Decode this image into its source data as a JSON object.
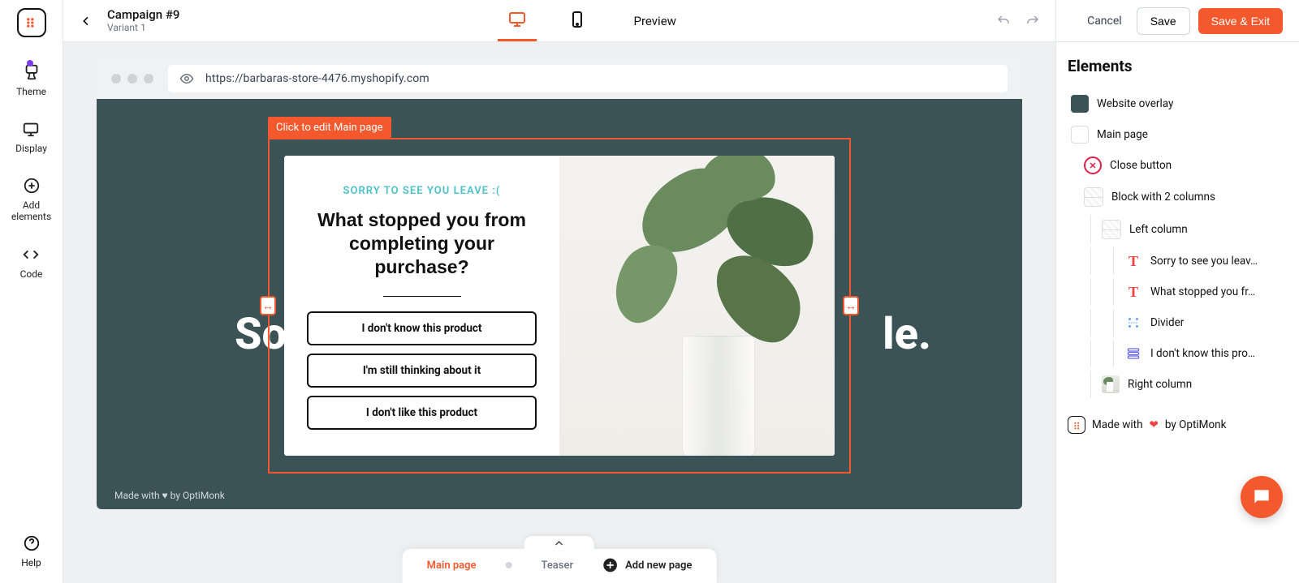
{
  "header": {
    "title": "Campaign #9",
    "subtitle": "Variant 1",
    "preview": "Preview",
    "cancel": "Cancel",
    "save": "Save",
    "save_exit": "Save & Exit"
  },
  "sidebar": {
    "theme": "Theme",
    "display": "Display",
    "add_elements": "Add\nelements",
    "code": "Code",
    "help": "Help"
  },
  "browser": {
    "url": "https://barbaras-store-4476.myshopify.com",
    "frame_label": "Click to edit Main page",
    "made_with": "Made with ♥ by OptiMonk",
    "bg_text_left": "So",
    "bg_text_right": "le."
  },
  "popup": {
    "eyebrow": "SORRY TO SEE YOU LEAVE :(",
    "heading": "What stopped you from completing your purchase?",
    "options": [
      "I don't know this product",
      "I'm still thinking about it",
      "I don't like this product"
    ]
  },
  "pages": {
    "main": "Main page",
    "teaser": "Teaser",
    "add": "Add new page"
  },
  "panel": {
    "title": "Elements",
    "overlay": "Website overlay",
    "main_page": "Main page",
    "close_button": "Close button",
    "block_2col": "Block with 2 columns",
    "left_col": "Left column",
    "sorry": "Sorry to see you leav…",
    "what_stopped": "What stopped you fr…",
    "divider": "Divider",
    "option1": "I don't know this pro…",
    "right_col": "Right column",
    "footer_pre": "Made with",
    "footer_post": "by OptiMonk"
  }
}
